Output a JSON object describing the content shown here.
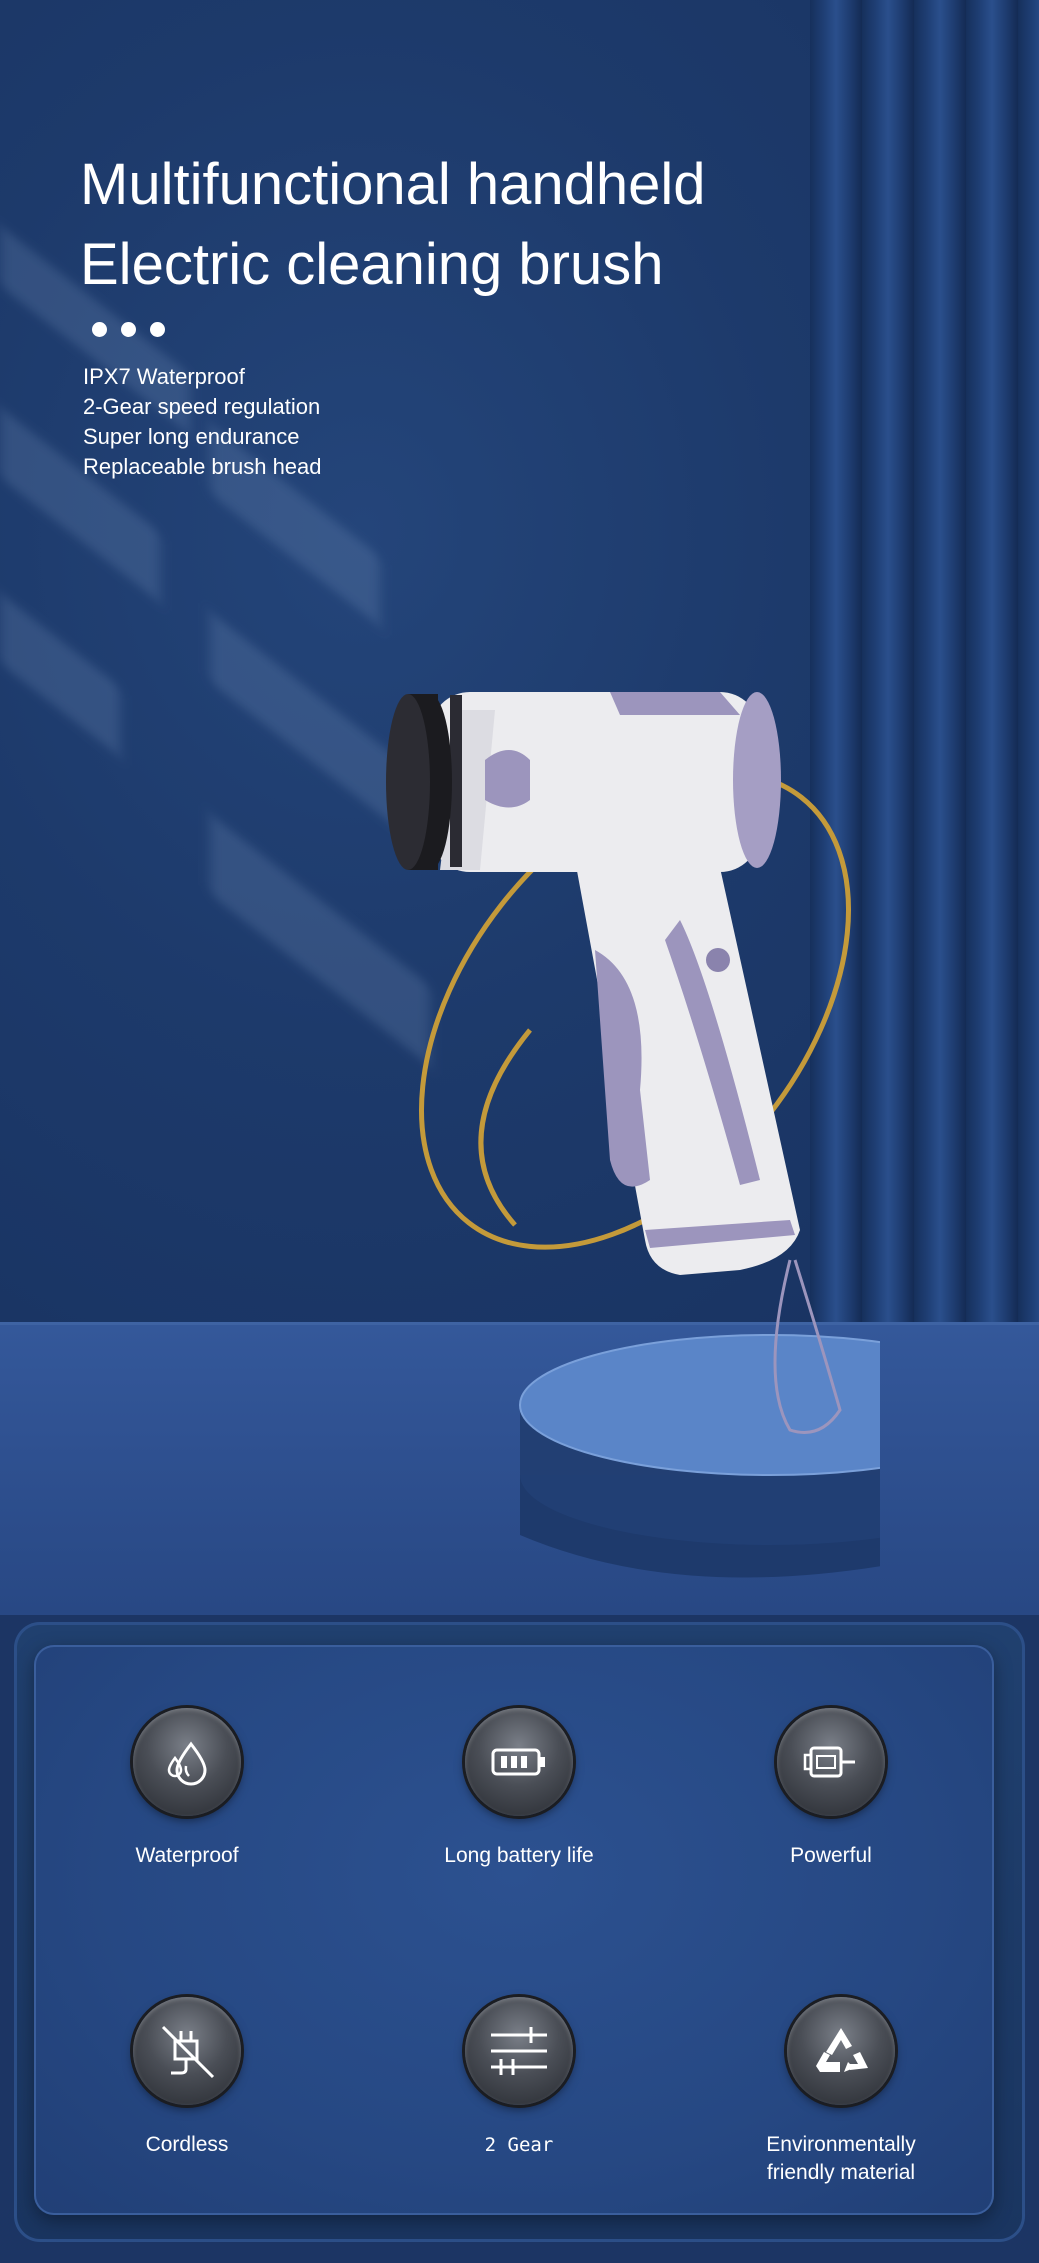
{
  "hero": {
    "title_line1": "Multifunctional handheld",
    "title_line2": "Electric cleaning brush",
    "features": [
      "IPX7 Waterproof",
      "2-Gear speed regulation",
      "Super long endurance",
      "Replaceable brush head"
    ]
  },
  "panel": {
    "items": [
      {
        "label": "Waterproof",
        "icon": "water-drop-icon"
      },
      {
        "label": "Long battery life",
        "icon": "battery-icon"
      },
      {
        "label": "Powerful",
        "icon": "motor-icon"
      },
      {
        "label": "Cordless",
        "icon": "no-plug-icon"
      },
      {
        "label": "2 Gear",
        "icon": "slider-icon"
      },
      {
        "label_line1": "Environmentally",
        "label_line2": "friendly material",
        "icon": "recycle-icon"
      }
    ]
  },
  "colors": {
    "wall": "#1d3a6b",
    "floor": "#2f5191",
    "panel": "#264883",
    "product_body": "#ededf0",
    "product_accent": "#9c95bd",
    "ring": "#c49a3a"
  }
}
